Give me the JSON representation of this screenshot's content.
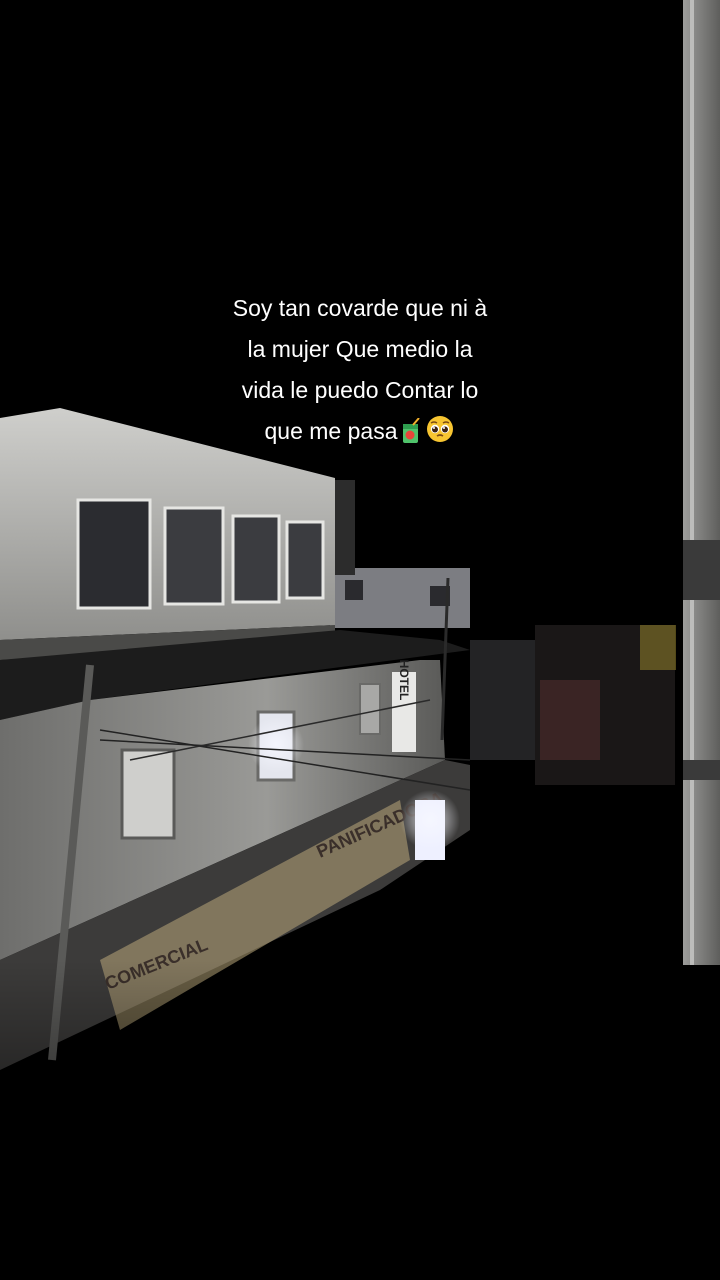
{
  "caption": {
    "lines": [
      "Soy tan covarde que ni à",
      "la mujer Que medio la",
      "vida le puedo Contar lo",
      "que me pasa"
    ],
    "emojis": [
      "juice-box-emoji",
      "pleading-face-emoji"
    ]
  },
  "signs": {
    "hotel": "HOTEL",
    "bakery": "PANIFICADORA",
    "store": "COMERCIAL"
  },
  "colors": {
    "sky": "#000000",
    "building": "#d9d9d6",
    "caption_text": "#ffffff",
    "window_light": "#f4f6ff"
  }
}
